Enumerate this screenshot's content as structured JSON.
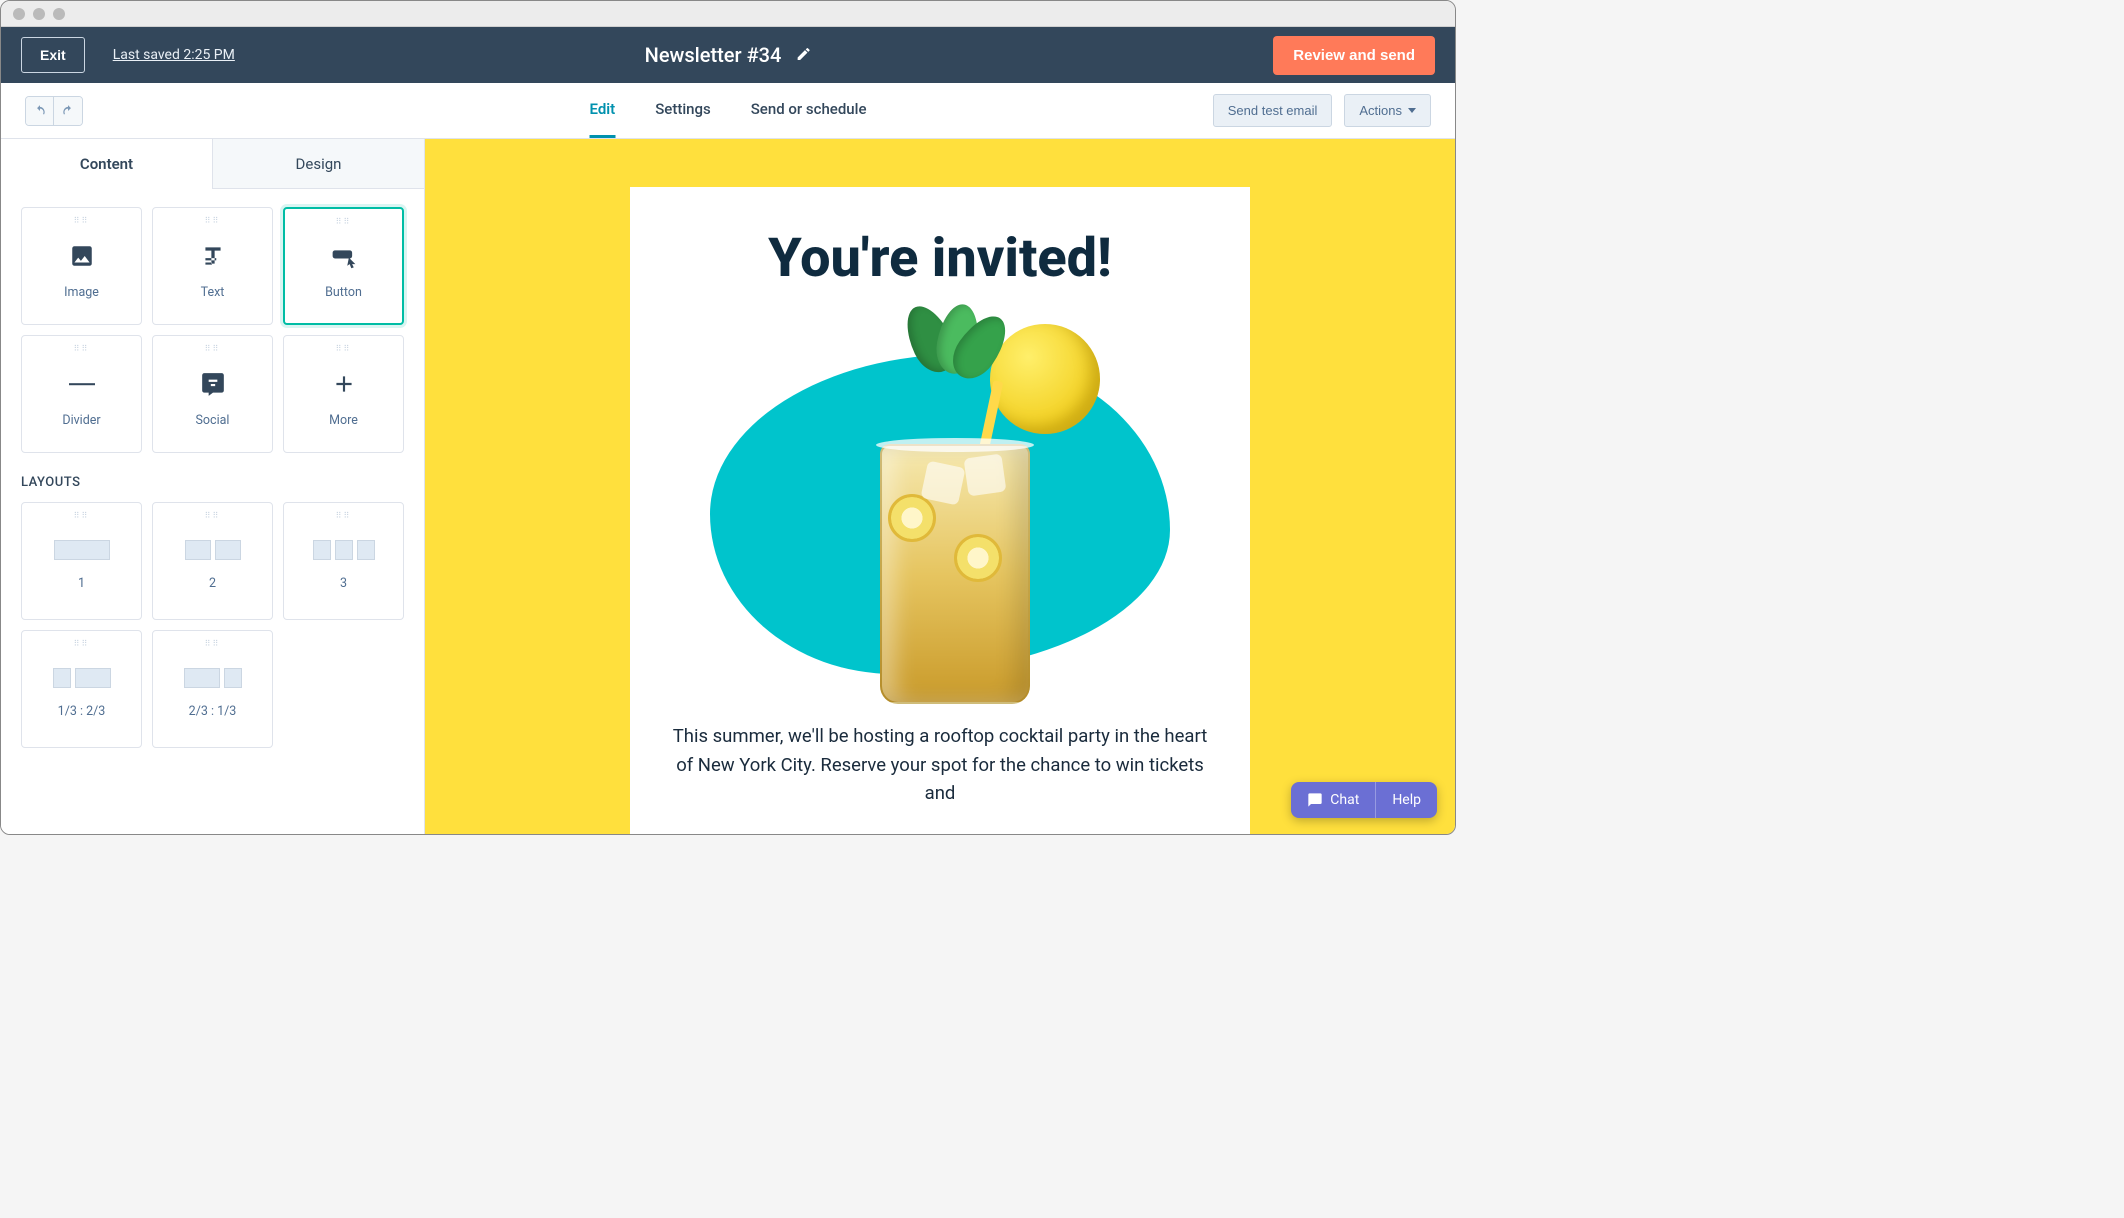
{
  "header": {
    "exit": "Exit",
    "last_saved": "Last saved 2:25 PM",
    "title": "Newsletter #34",
    "review": "Review and send"
  },
  "subnav": {
    "tabs": [
      "Edit",
      "Settings",
      "Send or schedule"
    ],
    "active_tab": "Edit",
    "send_test": "Send test email",
    "actions": "Actions"
  },
  "sidebar": {
    "tabs": [
      "Content",
      "Design"
    ],
    "active_tab": "Content",
    "blocks": [
      {
        "label": "Image",
        "icon": "image-icon"
      },
      {
        "label": "Text",
        "icon": "text-icon"
      },
      {
        "label": "Button",
        "icon": "button-icon",
        "selected": true
      },
      {
        "label": "Divider",
        "icon": "divider-icon"
      },
      {
        "label": "Social",
        "icon": "social-icon"
      },
      {
        "label": "More",
        "icon": "plus-icon"
      }
    ],
    "layouts_label": "LAYOUTS",
    "layouts": [
      {
        "label": "1",
        "cols": [
          56
        ]
      },
      {
        "label": "2",
        "cols": [
          26,
          26
        ]
      },
      {
        "label": "3",
        "cols": [
          18,
          18,
          18
        ]
      },
      {
        "label": "1/3 : 2/3",
        "cols": [
          18,
          36
        ]
      },
      {
        "label": "2/3 : 1/3",
        "cols": [
          36,
          18
        ]
      }
    ]
  },
  "canvas": {
    "bg_color": "#ffe03d",
    "heading": "You're invited!",
    "body": "This summer, we'll be hosting a rooftop cocktail party in the heart of New York City. Reserve your spot for the chance to win tickets and"
  },
  "chat": {
    "chat": "Chat",
    "help": "Help"
  },
  "colors": {
    "accent": "#ff7a59",
    "teal": "#0091ae",
    "dark": "#33475b"
  }
}
